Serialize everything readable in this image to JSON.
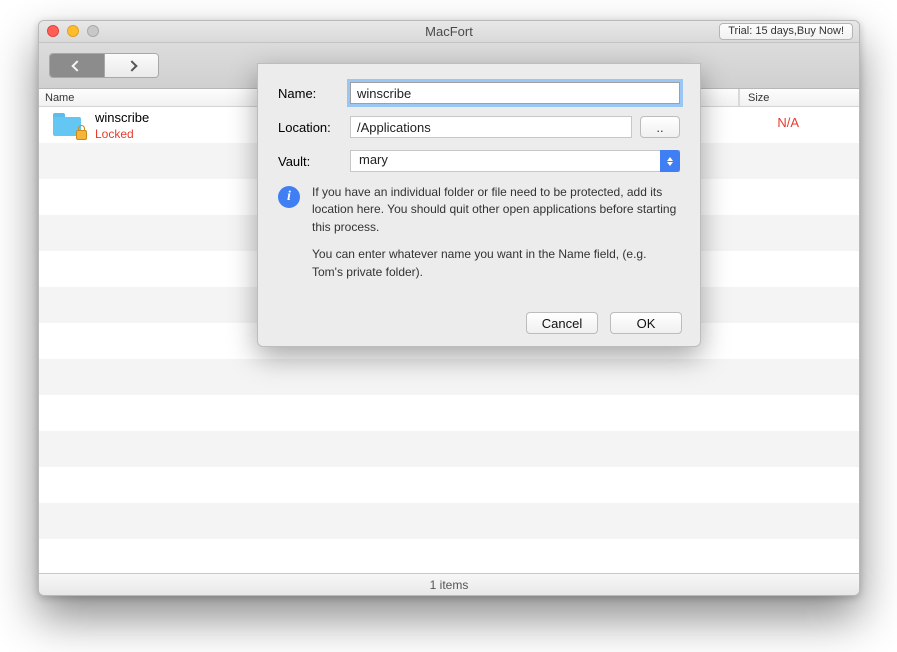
{
  "window": {
    "title": "MacFort",
    "trial_label": "Trial: 15 days,Buy Now!"
  },
  "columns": {
    "name_header": "Name",
    "size_header": "Size"
  },
  "item": {
    "name": "winscribe",
    "status": "Locked",
    "size": "N/A"
  },
  "footer": {
    "status": "1 items"
  },
  "dialog": {
    "name_label": "Name:",
    "name_value": "winscribe",
    "location_label": "Location:",
    "location_value": "/Applications",
    "browse_label": "..",
    "vault_label": "Vault:",
    "vault_value": "mary",
    "info_line1": "If you have an individual folder or file need to be protected, add its location here. You should quit other open applications before starting this process.",
    "info_line2": "You can enter whatever name you want in the Name field, (e.g. Tom's private folder).",
    "cancel_label": "Cancel",
    "ok_label": "OK"
  }
}
